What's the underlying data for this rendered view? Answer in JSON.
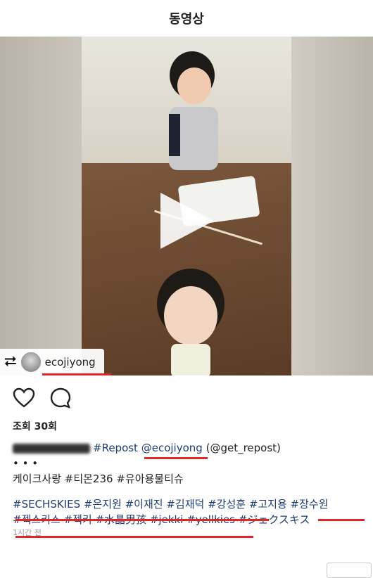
{
  "header": {
    "title": "동영상"
  },
  "post": {
    "repost_username": "ecojiyong",
    "views_label": "조회 30회",
    "caption": {
      "line1": {
        "tag1": "#Repost",
        "mention": "@ecojiyong",
        "via": "(@get_repost)"
      },
      "dots": "• • •",
      "line3": "케이크사랑 #티몬236 #유아용물티슈",
      "line4": "#SECHSKIES #은지원 #이재진 #김재덕 #강성훈 #고지용 #장수원",
      "line5": "#젝스키스 #젝키 #水晶男孩 #jekki #yellkies #ジェクスキス"
    },
    "timestamp": "1시간 전"
  },
  "icons": {
    "like": "heart-icon",
    "comment": "comment-bubble-icon",
    "repost": "repost-icon",
    "play": "play-icon"
  },
  "colors": {
    "underline": "#e0262a",
    "hashtag": "#1d3b6e"
  }
}
